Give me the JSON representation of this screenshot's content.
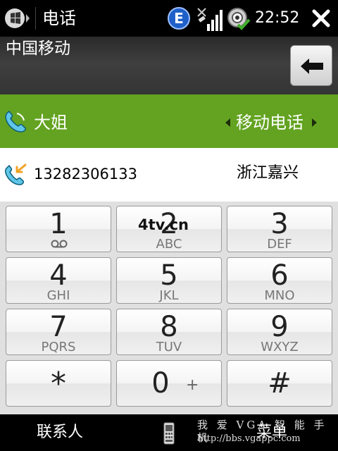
{
  "status_bar": {
    "app_title": "电话",
    "edge_badge": "E",
    "time": "22:52"
  },
  "dial": {
    "carrier": "中国移动"
  },
  "contact": {
    "name": "大姐",
    "phone_type": "移动电话"
  },
  "number_row": {
    "number": "13282306133",
    "location": "浙江嘉兴"
  },
  "keypad": {
    "keys": [
      {
        "digit": "1",
        "letters": ""
      },
      {
        "digit": "2",
        "letters": "ABC"
      },
      {
        "digit": "3",
        "letters": "DEF"
      },
      {
        "digit": "4",
        "letters": "GHI"
      },
      {
        "digit": "5",
        "letters": "JKL"
      },
      {
        "digit": "6",
        "letters": "MNO"
      },
      {
        "digit": "7",
        "letters": "PQRS"
      },
      {
        "digit": "8",
        "letters": "TUV"
      },
      {
        "digit": "9",
        "letters": "WXYZ"
      },
      {
        "digit": "*",
        "letters": ""
      },
      {
        "digit": "0",
        "letters": "+"
      },
      {
        "digit": "#",
        "letters": ""
      }
    ]
  },
  "softkeys": {
    "left": "联系人",
    "right": "菜单"
  },
  "watermarks": {
    "site": "4tv.cn",
    "forum": "我 爱 VGA 智 能 手 机",
    "url": "http://bbs.vgappc.com"
  },
  "colors": {
    "contact_row": "#63a321",
    "status_bar": "#000000"
  },
  "icons": {
    "start": "windows-start-icon",
    "edge": "edge-data-icon",
    "signal": "signal-strength-icon",
    "sync": "sync-status-icon",
    "close": "close-icon",
    "backspace": "backspace-arrow-icon",
    "contact": "phone-handset-icon",
    "incoming": "incoming-call-icon",
    "voicemail": "voicemail-icon",
    "input_panel": "input-panel-icon"
  }
}
